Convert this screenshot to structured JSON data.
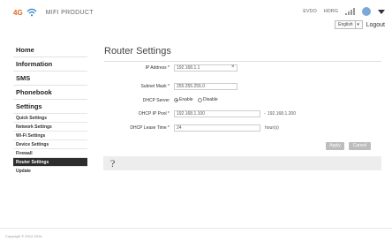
{
  "header": {
    "brand_badge": "4G",
    "brand_name": "MIFI PRODUCT",
    "status": {
      "network": "EVDO",
      "roaming": "HDRG"
    },
    "language": "English",
    "logout": "Logout"
  },
  "sidebar": {
    "main": [
      "Home",
      "Information",
      "SMS",
      "Phonebook",
      "Settings"
    ],
    "sub": [
      {
        "label": "Quick Settings"
      },
      {
        "label": "Network Settings"
      },
      {
        "label": "Wi-Fi Settings"
      },
      {
        "label": "Device Settings"
      },
      {
        "label": "Firewall"
      },
      {
        "label": "Router Settings",
        "active": true
      },
      {
        "label": "Update"
      }
    ]
  },
  "main": {
    "title": "Router Settings",
    "ip_label": "IP Address *",
    "ip_value": "192.168.1.1",
    "mask_label": "Subnet Mask *",
    "mask_value": "255.255.255.0",
    "dhcp_label": "DHCP Server",
    "enable": "Enable",
    "disable": "Disable",
    "pool_label": "DHCP IP Pool *",
    "pool_start": "192.168.1.100",
    "pool_sep": "-",
    "pool_end": "192.168.1.200",
    "lease_label": "DHCP Lease Time *",
    "lease_value": "24",
    "lease_unit": "hour(s)",
    "apply": "Apply",
    "cancel": "Cancel",
    "help": "?"
  },
  "footer": {
    "copyright": "Copyright © 2012-2014"
  }
}
